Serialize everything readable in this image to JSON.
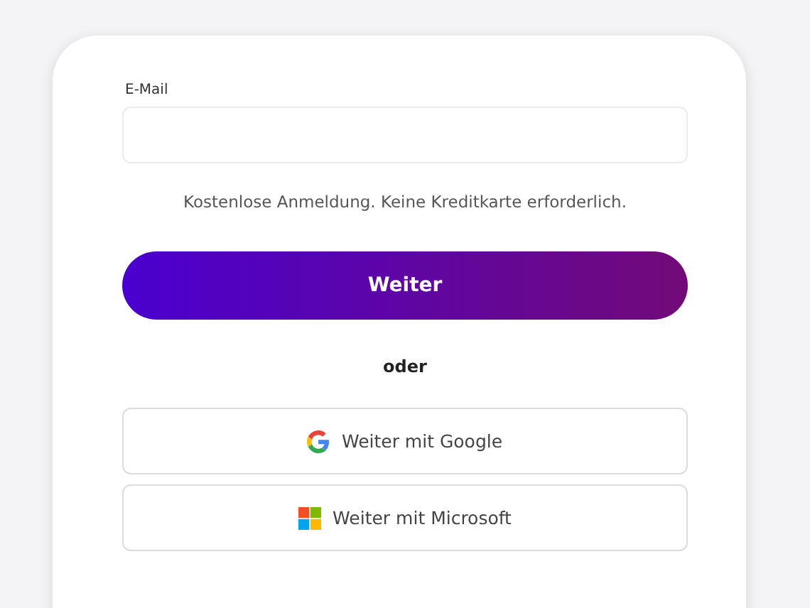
{
  "email_field": {
    "label": "E-Mail"
  },
  "note": "Kostenlose Anmeldung. Keine Kreditkarte erforderlich.",
  "continue_button": "Weiter",
  "divider": "oder",
  "providers": [
    {
      "kind": "google",
      "label": "Weiter mit Google"
    },
    {
      "kind": "microsoft",
      "label": "Weiter mit Microsoft"
    }
  ]
}
